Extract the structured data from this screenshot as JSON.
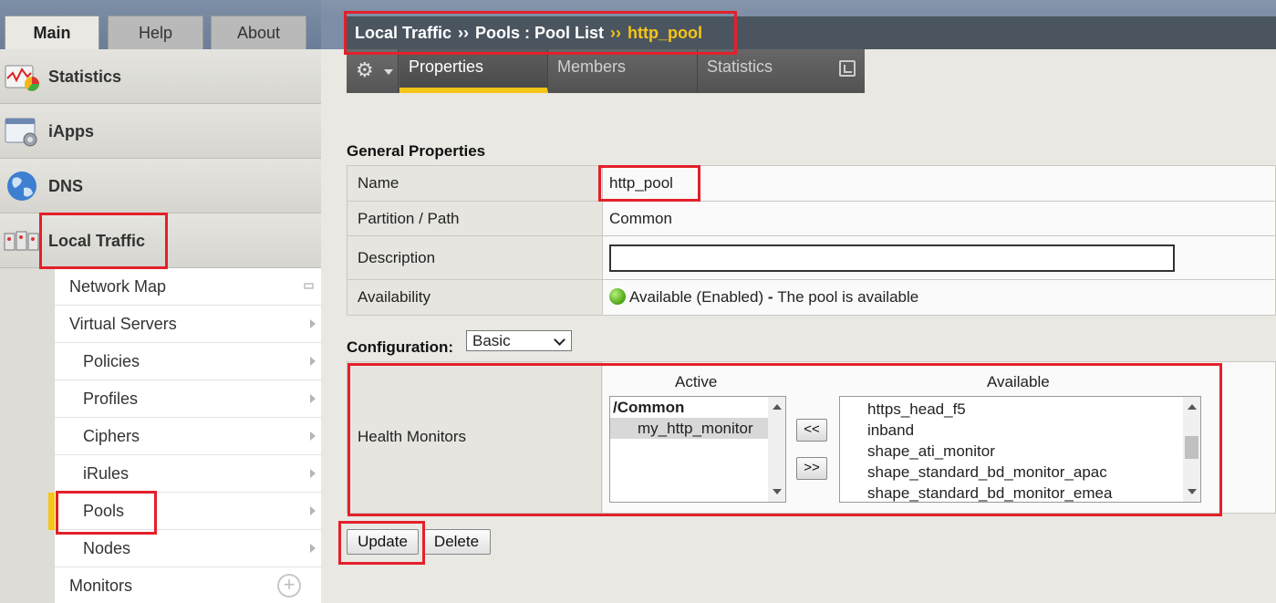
{
  "top_tabs": [
    {
      "label": "Main"
    },
    {
      "label": "Help"
    },
    {
      "label": "About"
    }
  ],
  "nav": {
    "sections": [
      {
        "label": "Statistics",
        "icon": "statistics-icon"
      },
      {
        "label": "iApps",
        "icon": "iapps-icon"
      },
      {
        "label": "DNS",
        "icon": "dns-globe-icon"
      },
      {
        "label": "Local Traffic",
        "icon": "local-traffic-icon"
      }
    ],
    "local_traffic_items": [
      {
        "label": "Network Map"
      },
      {
        "label": "Virtual Servers"
      },
      {
        "label": "Policies"
      },
      {
        "label": "Profiles"
      },
      {
        "label": "Ciphers"
      },
      {
        "label": "iRules"
      },
      {
        "label": "Pools"
      },
      {
        "label": "Nodes"
      },
      {
        "label": "Monitors"
      }
    ]
  },
  "breadcrumb": {
    "part1": "Local Traffic",
    "sep1": "››",
    "part2": "Pools : Pool List",
    "sep2": "››",
    "current": "http_pool"
  },
  "page_tabs": [
    {
      "label": "Properties"
    },
    {
      "label": "Members"
    },
    {
      "label": "Statistics"
    }
  ],
  "general": {
    "heading": "General Properties",
    "name_label": "Name",
    "name_value": "http_pool",
    "partition_label": "Partition / Path",
    "partition_value": "Common",
    "description_label": "Description",
    "description_value": "",
    "availability_label": "Availability",
    "availability_status": "Available (Enabled)",
    "availability_sep": " - ",
    "availability_text": "The pool is available"
  },
  "configuration": {
    "label": "Configuration:",
    "selected": "Basic"
  },
  "health_monitors": {
    "label": "Health Monitors",
    "active_header": "Active",
    "available_header": "Available",
    "active_group": "/Common",
    "active_items": [
      "my_http_monitor"
    ],
    "available_items": [
      "https_head_f5",
      "inband",
      "shape_ati_monitor",
      "shape_standard_bd_monitor_apac",
      "shape_standard_bd_monitor_emea"
    ],
    "add_button": "<<",
    "remove_button": ">>"
  },
  "actions": {
    "update": "Update",
    "delete": "Delete"
  },
  "colors": {
    "accent": "#f5c518",
    "highlight_box": "#e3202a",
    "breadcrumb_bg": "#4b5560",
    "available_dot": "#4aa312"
  }
}
